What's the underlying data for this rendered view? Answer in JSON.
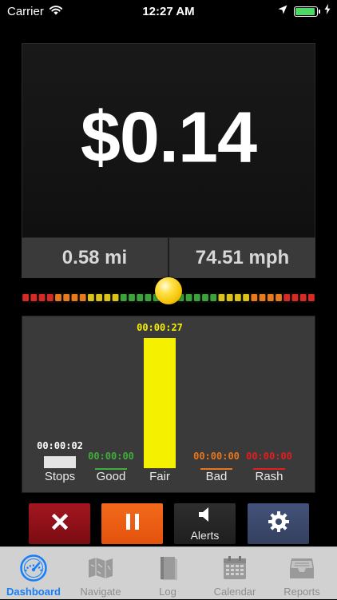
{
  "status_bar": {
    "carrier": "Carrier",
    "time": "12:27 AM",
    "battery_level": 1.0,
    "battery_color": "#4cd964",
    "icons": [
      "wifi-icon",
      "location-arrow-icon",
      "battery-icon",
      "charging-bolt-icon"
    ]
  },
  "trip": {
    "cost": "$0.14",
    "distance": "0.58 mi",
    "speed": "74.51 mph"
  },
  "driving_meter": {
    "knob_position": 0.5,
    "colors": {
      "red": "#d62a24",
      "orange": "#e67a1c",
      "yellow": "#d9c21a",
      "green": "#3aa33a"
    }
  },
  "time_bars": [
    {
      "label": "Stops",
      "time": "00:00:02",
      "value": 2,
      "time_color": "#ffffff",
      "color": "#e4e4e4",
      "style": "bar"
    },
    {
      "label": "Good",
      "time": "00:00:00",
      "value": 0,
      "time_color": "#3fae3a",
      "color": "#3fae3a",
      "style": "line"
    },
    {
      "label": "Fair",
      "time": "00:00:27",
      "value": 27,
      "time_color": "#f5f000",
      "color": "#f5f000",
      "style": "bar"
    },
    {
      "label": "Bad",
      "time": "00:00:00",
      "value": 0,
      "time_color": "#e8761c",
      "color": "#e8761c",
      "style": "line"
    },
    {
      "label": "Rash",
      "time": "00:00:00",
      "value": 0,
      "time_color": "#e21e1e",
      "color": "#e21e1e",
      "style": "line"
    }
  ],
  "toolbar": {
    "stop_icon": "x-icon",
    "pause_icon": "pause-icon",
    "alerts_label": "Alerts",
    "alerts_icon": "speaker-icon",
    "settings_icon": "gear-icon",
    "colors": {
      "stop": "#8e1118",
      "pause": "#ec5a12",
      "alerts": "#2a2a2a",
      "settings": "#3a4a6a"
    }
  },
  "tab_bar": {
    "active_color": "#157efb",
    "items": [
      {
        "label": "Dashboard",
        "icon": "speedometer-icon",
        "active": true
      },
      {
        "label": "Navigate",
        "icon": "map-icon",
        "active": false
      },
      {
        "label": "Log",
        "icon": "book-icon",
        "active": false
      },
      {
        "label": "Calendar",
        "icon": "calendar-icon",
        "active": false
      },
      {
        "label": "Reports",
        "icon": "inbox-tray-icon",
        "active": false
      }
    ]
  }
}
